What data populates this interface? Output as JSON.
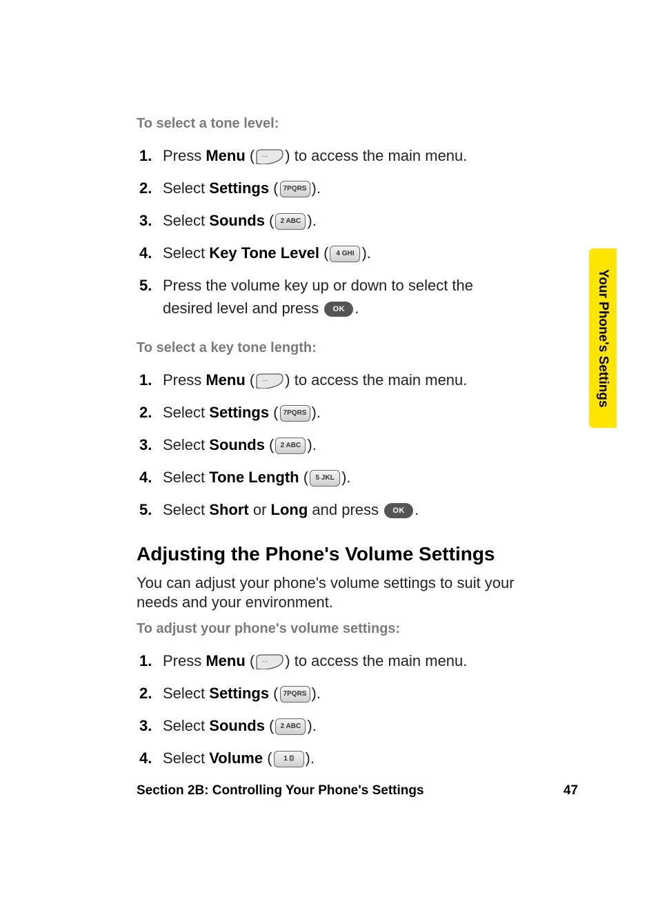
{
  "sidetab": {
    "label": "Your Phone's Settings"
  },
  "section1": {
    "intro": "To select a tone level:",
    "steps": [
      {
        "n": "1.",
        "pre": "Press ",
        "bold": "Menu",
        "post1": " (",
        "key": "menu",
        "post2": ") to access the main menu."
      },
      {
        "n": "2.",
        "pre": "Select ",
        "bold": "Settings",
        "post1": " (",
        "key": "7PQRS",
        "post2": ")."
      },
      {
        "n": "3.",
        "pre": "Select ",
        "bold": "Sounds",
        "post1": " (",
        "key": "2 ABC",
        "post2": ")."
      },
      {
        "n": "4.",
        "pre": "Select ",
        "bold": "Key Tone Level",
        "post1": " (",
        "key": "4 GHI",
        "post2": ")."
      },
      {
        "n": "5.",
        "pre": "Press the volume key up or down to select the desired level and press ",
        "bold": "",
        "post1": "",
        "key": "ok",
        "post2": "."
      }
    ]
  },
  "section2": {
    "intro": "To select a key tone length:",
    "steps": [
      {
        "n": "1.",
        "pre": "Press ",
        "bold": "Menu",
        "post1": " (",
        "key": "menu",
        "post2": ") to access the main menu."
      },
      {
        "n": "2.",
        "pre": "Select ",
        "bold": "Settings",
        "post1": " (",
        "key": "7PQRS",
        "post2": ")."
      },
      {
        "n": "3.",
        "pre": "Select ",
        "bold": "Sounds",
        "post1": " (",
        "key": "2 ABC",
        "post2": ")."
      },
      {
        "n": "4.",
        "pre": "Select ",
        "bold": "Tone Length",
        "post1": " (",
        "key": "5 JKL",
        "post2": ")."
      },
      {
        "n": "5.",
        "pre": "Select ",
        "bold": "Short",
        "post1": " or ",
        "bold2": "Long",
        "post2": " and press ",
        "key": "ok",
        "post3": "."
      }
    ]
  },
  "heading": "Adjusting the Phone's Volume Settings",
  "bodypara": "You can adjust your phone's volume settings to suit your needs and your environment.",
  "section3": {
    "intro": "To adjust your phone's volume settings:",
    "steps": [
      {
        "n": "1.",
        "pre": "Press ",
        "bold": "Menu",
        "post1": " (",
        "key": "menu",
        "post2": ") to access the main menu."
      },
      {
        "n": "2.",
        "pre": "Select ",
        "bold": "Settings",
        "post1": " (",
        "key": "7PQRS",
        "post2": ")."
      },
      {
        "n": "3.",
        "pre": "Select ",
        "bold": "Sounds",
        "post1": " (",
        "key": "2 ABC",
        "post2": ")."
      },
      {
        "n": "4.",
        "pre": "Select ",
        "bold": "Volume",
        "post1": " (",
        "key": "1 ⌼",
        "post2": ")."
      }
    ]
  },
  "footer": {
    "left": "Section 2B: Controlling Your Phone's Settings",
    "right": "47"
  },
  "icons": {
    "ok": "OK"
  }
}
